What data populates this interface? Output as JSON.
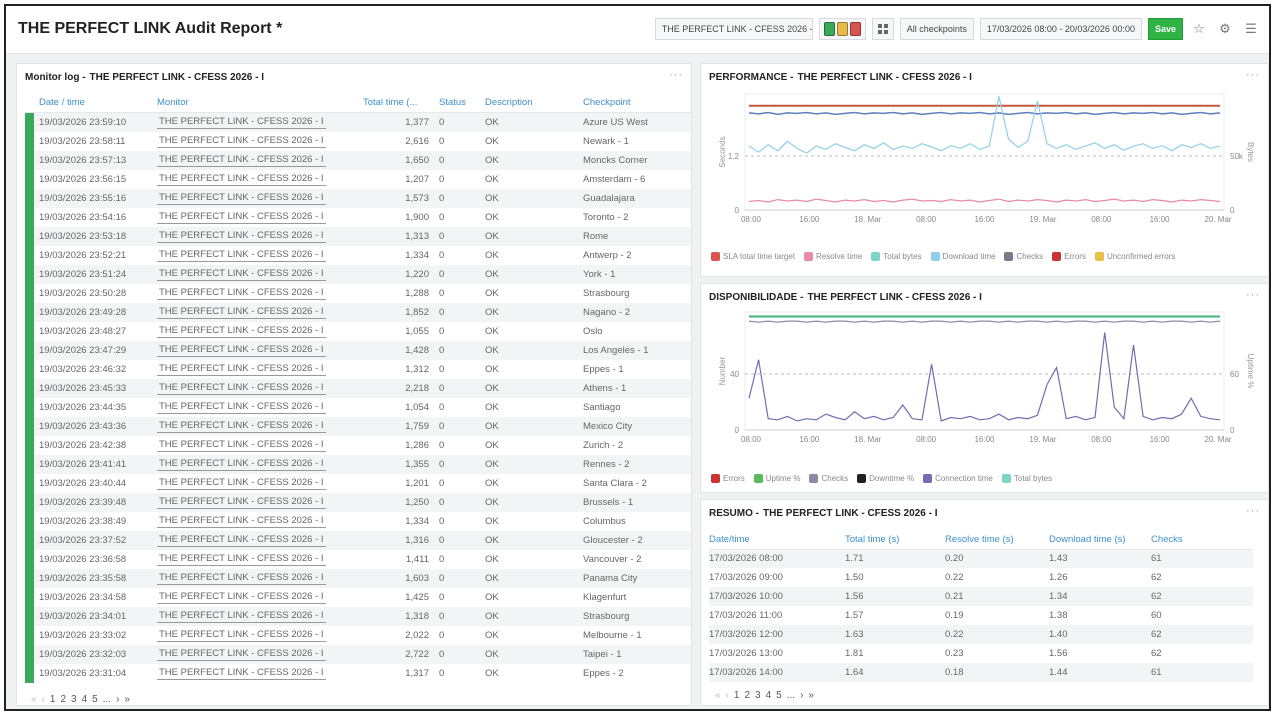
{
  "header": {
    "title": "THE PERFECT LINK Audit Report *",
    "monitor_select": "THE PERFECT LINK - CFESS 2026 - I",
    "status_squares": [
      "#3aaa5a",
      "#e9b949",
      "#d9534f"
    ],
    "checkpoints_label": "All checkpoints",
    "date_range": "17/03/2026 08:00 - 20/03/2026 00:00",
    "save_label": "Save"
  },
  "monitor_log": {
    "title": "Monitor log -",
    "subtitle": "THE PERFECT LINK - CFESS 2026 - I",
    "columns": [
      "Date / time",
      "Monitor",
      "Total time (...",
      "Status",
      "Description",
      "Checkpoint"
    ],
    "rows": [
      [
        "19/03/2026 23:59:10",
        "THE PERFECT LINK - CFESS 2026 - I",
        "1,377",
        "0",
        "OK",
        "Azure US West"
      ],
      [
        "19/03/2026 23:58:11",
        "THE PERFECT LINK - CFESS 2026 - I",
        "2,616",
        "0",
        "OK",
        "Newark - 1"
      ],
      [
        "19/03/2026 23:57:13",
        "THE PERFECT LINK - CFESS 2026 - I",
        "1,650",
        "0",
        "OK",
        "Moncks Corner"
      ],
      [
        "19/03/2026 23:56:15",
        "THE PERFECT LINK - CFESS 2026 - I",
        "1,207",
        "0",
        "OK",
        "Amsterdam - 6"
      ],
      [
        "19/03/2026 23:55:16",
        "THE PERFECT LINK - CFESS 2026 - I",
        "1,573",
        "0",
        "OK",
        "Guadalajara"
      ],
      [
        "19/03/2026 23:54:16",
        "THE PERFECT LINK - CFESS 2026 - I",
        "1,900",
        "0",
        "OK",
        "Toronto - 2"
      ],
      [
        "19/03/2026 23:53:18",
        "THE PERFECT LINK - CFESS 2026 - I",
        "1,313",
        "0",
        "OK",
        "Rome"
      ],
      [
        "19/03/2026 23:52:21",
        "THE PERFECT LINK - CFESS 2026 - I",
        "1,334",
        "0",
        "OK",
        "Antwerp - 2"
      ],
      [
        "19/03/2026 23:51:24",
        "THE PERFECT LINK - CFESS 2026 - I",
        "1,220",
        "0",
        "OK",
        "York - 1"
      ],
      [
        "19/03/2026 23:50:28",
        "THE PERFECT LINK - CFESS 2026 - I",
        "1,288",
        "0",
        "OK",
        "Strasbourg"
      ],
      [
        "19/03/2026 23:49:28",
        "THE PERFECT LINK - CFESS 2026 - I",
        "1,852",
        "0",
        "OK",
        "Nagano - 2"
      ],
      [
        "19/03/2026 23:48:27",
        "THE PERFECT LINK - CFESS 2026 - I",
        "1,055",
        "0",
        "OK",
        "Oslo"
      ],
      [
        "19/03/2026 23:47:29",
        "THE PERFECT LINK - CFESS 2026 - I",
        "1,428",
        "0",
        "OK",
        "Los Angeles - 1"
      ],
      [
        "19/03/2026 23:46:32",
        "THE PERFECT LINK - CFESS 2026 - I",
        "1,312",
        "0",
        "OK",
        "Eppes - 1"
      ],
      [
        "19/03/2026 23:45:33",
        "THE PERFECT LINK - CFESS 2026 - I",
        "2,218",
        "0",
        "OK",
        "Athens - 1"
      ],
      [
        "19/03/2026 23:44:35",
        "THE PERFECT LINK - CFESS 2026 - I",
        "1,054",
        "0",
        "OK",
        "Santiago"
      ],
      [
        "19/03/2026 23:43:36",
        "THE PERFECT LINK - CFESS 2026 - I",
        "1,759",
        "0",
        "OK",
        "Mexico City"
      ],
      [
        "19/03/2026 23:42:38",
        "THE PERFECT LINK - CFESS 2026 - I",
        "1,286",
        "0",
        "OK",
        "Zurich - 2"
      ],
      [
        "19/03/2026 23:41:41",
        "THE PERFECT LINK - CFESS 2026 - I",
        "1,355",
        "0",
        "OK",
        "Rennes - 2"
      ],
      [
        "19/03/2026 23:40:44",
        "THE PERFECT LINK - CFESS 2026 - I",
        "1,201",
        "0",
        "OK",
        "Santa Clara - 2"
      ],
      [
        "19/03/2026 23:39:48",
        "THE PERFECT LINK - CFESS 2026 - I",
        "1,250",
        "0",
        "OK",
        "Brussels - 1"
      ],
      [
        "19/03/2026 23:38:49",
        "THE PERFECT LINK - CFESS 2026 - I",
        "1,334",
        "0",
        "OK",
        "Columbus"
      ],
      [
        "19/03/2026 23:37:52",
        "THE PERFECT LINK - CFESS 2026 - I",
        "1,316",
        "0",
        "OK",
        "Gloucester - 2"
      ],
      [
        "19/03/2026 23:36:58",
        "THE PERFECT LINK - CFESS 2026 - I",
        "1,411",
        "0",
        "OK",
        "Vancouver - 2"
      ],
      [
        "19/03/2026 23:35:58",
        "THE PERFECT LINK - CFESS 2026 - I",
        "1,603",
        "0",
        "OK",
        "Panama City"
      ],
      [
        "19/03/2026 23:34:58",
        "THE PERFECT LINK - CFESS 2026 - I",
        "1,425",
        "0",
        "OK",
        "Klagenfurt"
      ],
      [
        "19/03/2026 23:34:01",
        "THE PERFECT LINK - CFESS 2026 - I",
        "1,318",
        "0",
        "OK",
        "Strasbourg"
      ],
      [
        "19/03/2026 23:33:02",
        "THE PERFECT LINK - CFESS 2026 - I",
        "2,022",
        "0",
        "OK",
        "Melbourne - 1"
      ],
      [
        "19/03/2026 23:32:03",
        "THE PERFECT LINK - CFESS 2026 - I",
        "2,722",
        "0",
        "OK",
        "Taipei - 1"
      ],
      [
        "19/03/2026 23:31:04",
        "THE PERFECT LINK - CFESS 2026 - I",
        "1,317",
        "0",
        "OK",
        "Eppes - 2"
      ]
    ],
    "pager": {
      "first": "«",
      "prev": "‹",
      "pages": [
        "1",
        "2",
        "3",
        "4",
        "5",
        "..."
      ],
      "next": "›",
      "last": "»"
    }
  },
  "performance": {
    "title": "PERFORMANCE -",
    "subtitle": "THE PERFECT LINK - CFESS 2026 - I",
    "left_axis_label": "Seconds",
    "right_axis_label": "Bytes",
    "legend": [
      {
        "label": "SLA total time target",
        "color": "#d9534f"
      },
      {
        "label": "Resolve time",
        "color": "#e88aa6"
      },
      {
        "label": "Total bytes",
        "color": "#7fd3c7"
      },
      {
        "label": "Download time",
        "color": "#8fd0e8"
      },
      {
        "label": "Checks",
        "color": "#7a7a8a"
      },
      {
        "label": "Errors",
        "color": "#cc3333"
      },
      {
        "label": "Unconfirmed errors",
        "color": "#e6c24a"
      }
    ]
  },
  "availability": {
    "title": "DISPONIBILIDADE -",
    "subtitle": "THE PERFECT LINK - CFESS 2026 - I",
    "left_axis_label": "Number",
    "right_axis_label": "Uptime %",
    "legend": [
      {
        "label": "Errors",
        "color": "#cc3333"
      },
      {
        "label": "Uptime %",
        "color": "#5cb85c"
      },
      {
        "label": "Checks",
        "color": "#8a8aa0"
      },
      {
        "label": "Downtime %",
        "color": "#222222"
      },
      {
        "label": "Connection time",
        "color": "#6f6fb0"
      },
      {
        "label": "Total bytes",
        "color": "#7fd3c7"
      }
    ]
  },
  "chart_data": [
    {
      "type": "line",
      "title": "PERFORMANCE - THE PERFECT LINK - CFESS 2026 - I",
      "ylabel": "Seconds",
      "y2label": "Bytes",
      "x_ticks": [
        "08:00",
        "16:00",
        "18. Mar",
        "08:00",
        "16:00",
        "19. Mar",
        "08:00",
        "16:00",
        "20. Mar"
      ],
      "y_ticks": [
        "0",
        "1.2"
      ],
      "y2_ticks": [
        "0",
        "50k"
      ],
      "grid": true,
      "legend_position": "bottom",
      "series": [
        {
          "name": "SLA total time target",
          "color": "#c8553d",
          "values": [
            2.2,
            2.2,
            2.2,
            2.2,
            2.2,
            2.2,
            2.2,
            2.2,
            2.2,
            2.2,
            2.2,
            2.2,
            2.2,
            2.2,
            2.2,
            2.2,
            2.2,
            2.2,
            2.2,
            2.2,
            2.2,
            2.2,
            2.2,
            2.2,
            2.2,
            2.2,
            2.2,
            2.2,
            2.2,
            2.2,
            2.2,
            2.2,
            2.2,
            2.2,
            2.2,
            2.2,
            2.2,
            2.2,
            2.2,
            2.2,
            2.2,
            2.2,
            2.2,
            2.2,
            2.2,
            2.2,
            2.2,
            2.2,
            2.2,
            2.2
          ]
        },
        {
          "name": "Total bytes",
          "color": "#5b7fbf",
          "values": [
            2.05,
            2.03,
            2.06,
            2.02,
            2.05,
            2.04,
            2.06,
            2.03,
            2.05,
            2.02,
            2.04,
            2.06,
            2.03,
            2.05,
            2.04,
            2.06,
            2.03,
            2.05,
            2.02,
            2.04,
            2.06,
            2.03,
            2.05,
            2.04,
            2.06,
            2.03,
            2.05,
            2.02,
            2.04,
            2.06,
            2.03,
            2.05,
            2.04,
            2.06,
            2.03,
            2.05,
            2.02,
            2.04,
            2.06,
            2.03,
            2.05,
            2.04,
            2.06,
            2.03,
            2.05,
            2.02,
            2.04,
            2.06,
            2.03,
            2.05
          ]
        },
        {
          "name": "Download time",
          "color": "#8fd0e8",
          "values": [
            1.35,
            1.22,
            1.38,
            1.25,
            1.45,
            1.3,
            1.2,
            1.35,
            1.28,
            1.4,
            1.32,
            1.25,
            1.38,
            1.3,
            1.42,
            1.28,
            1.35,
            1.3,
            1.4,
            1.33,
            1.25,
            1.36,
            1.3,
            1.4,
            1.28,
            1.35,
            2.4,
            1.5,
            1.32,
            1.45,
            2.3,
            1.4,
            1.3,
            1.38,
            1.28,
            1.35,
            1.42,
            1.3,
            1.38,
            1.26,
            1.35,
            1.4,
            1.3,
            1.36,
            1.25,
            1.38,
            1.32,
            1.4,
            1.3,
            1.35
          ]
        },
        {
          "name": "Resolve time",
          "color": "#e88aa6",
          "values": [
            0.18,
            0.2,
            0.17,
            0.22,
            0.19,
            0.21,
            0.18,
            0.23,
            0.2,
            0.17,
            0.21,
            0.19,
            0.22,
            0.18,
            0.2,
            0.17,
            0.21,
            0.23,
            0.19,
            0.2,
            0.18,
            0.22,
            0.19,
            0.21,
            0.17,
            0.2,
            0.23,
            0.18,
            0.21,
            0.19,
            0.22,
            0.2,
            0.17,
            0.21,
            0.19,
            0.22,
            0.18,
            0.2,
            0.23,
            0.19,
            0.21,
            0.18,
            0.22,
            0.2,
            0.17,
            0.21,
            0.19,
            0.22,
            0.2,
            0.18
          ]
        }
      ]
    },
    {
      "type": "line",
      "title": "DISPONIBILIDADE - THE PERFECT LINK - CFESS 2026 - I",
      "ylabel": "Number",
      "y2label": "Uptime %",
      "x_ticks": [
        "08:00",
        "16:00",
        "18. Mar",
        "08:00",
        "16:00",
        "19. Mar",
        "08:00",
        "16:00",
        "20. Mar"
      ],
      "y_ticks": [
        "0",
        "40"
      ],
      "y2_ticks": [
        "0",
        "60"
      ],
      "grid": true,
      "legend_position": "bottom",
      "series": [
        {
          "name": "Uptime %",
          "color": "#3fb27f",
          "values": [
            100,
            100,
            100,
            100,
            100,
            100,
            100,
            100,
            100,
            100,
            100,
            100,
            100,
            100,
            100,
            100,
            100,
            100,
            100,
            100,
            100,
            100,
            100,
            100,
            100,
            100,
            100,
            100,
            100,
            100,
            100,
            100,
            100,
            100,
            100,
            100,
            100,
            100,
            100,
            100,
            100,
            100,
            100,
            100,
            100,
            100,
            100,
            100,
            100,
            100
          ]
        },
        {
          "name": "Checks",
          "color": "#8a8aa0",
          "values": [
            96,
            95,
            96,
            95,
            96,
            96,
            95,
            96,
            95,
            96,
            96,
            95,
            96,
            95,
            96,
            96,
            95,
            96,
            95,
            96,
            96,
            95,
            96,
            95,
            96,
            96,
            95,
            96,
            95,
            96,
            96,
            95,
            96,
            95,
            96,
            96,
            95,
            96,
            95,
            96,
            96,
            95,
            96,
            95,
            96,
            96,
            95,
            96,
            95,
            96
          ]
        },
        {
          "name": "Connection time",
          "color": "#6f6fb0",
          "values": [
            28,
            62,
            10,
            9,
            12,
            8,
            10,
            9,
            14,
            11,
            9,
            16,
            10,
            12,
            9,
            11,
            22,
            10,
            9,
            58,
            8,
            11,
            10,
            12,
            9,
            10,
            14,
            9,
            11,
            10,
            13,
            40,
            55,
            10,
            12,
            9,
            11,
            86,
            20,
            10,
            75,
            12,
            9,
            11,
            10,
            14,
            28,
            12,
            10,
            9
          ]
        }
      ]
    }
  ],
  "summary": {
    "title": "RESUMO -",
    "subtitle": "THE PERFECT LINK - CFESS 2026 - I",
    "columns": [
      "Date/time",
      "Total time (s)",
      "Resolve time (s)",
      "Download time (s)",
      "Checks"
    ],
    "rows": [
      [
        "17/03/2026 08:00",
        "1.71",
        "0.20",
        "1.43",
        "61"
      ],
      [
        "17/03/2026 09:00",
        "1.50",
        "0.22",
        "1.26",
        "62"
      ],
      [
        "17/03/2026 10:00",
        "1.56",
        "0.21",
        "1.34",
        "62"
      ],
      [
        "17/03/2026 11:00",
        "1.57",
        "0.19",
        "1.38",
        "60"
      ],
      [
        "17/03/2026 12:00",
        "1.63",
        "0.22",
        "1.40",
        "62"
      ],
      [
        "17/03/2026 13:00",
        "1.81",
        "0.23",
        "1.56",
        "62"
      ],
      [
        "17/03/2026 14:00",
        "1.64",
        "0.18",
        "1.44",
        "61"
      ]
    ],
    "pager": {
      "first": "«",
      "prev": "‹",
      "pages": [
        "1",
        "2",
        "3",
        "4",
        "5",
        "..."
      ],
      "next": "›",
      "last": "»"
    }
  }
}
